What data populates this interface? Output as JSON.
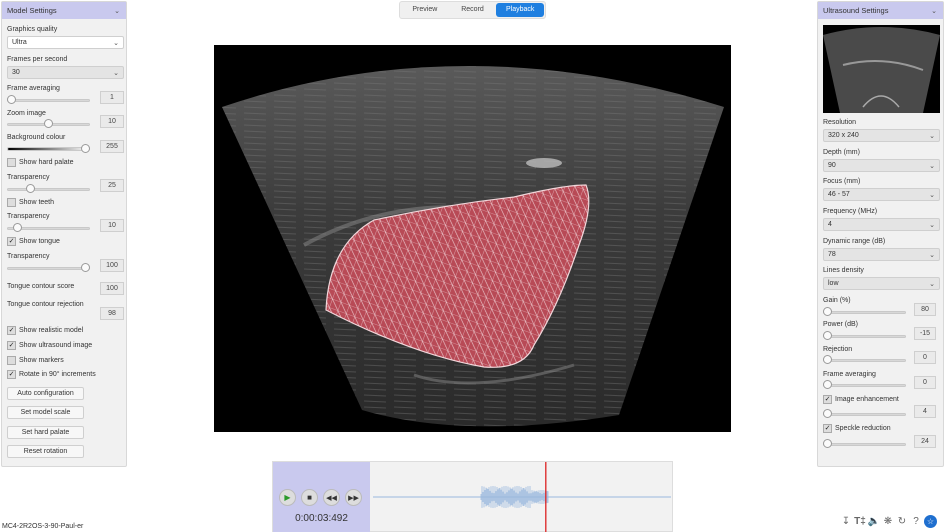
{
  "left_panel": {
    "title": "Model Settings",
    "graphics_quality": {
      "label": "Graphics quality",
      "value": "Ultra"
    },
    "fps": {
      "label": "Frames per second",
      "value": "30"
    },
    "frame_averaging": {
      "label": "Frame averaging",
      "value": "1",
      "level": 0.0
    },
    "zoom_image": {
      "label": "Zoom image",
      "value": "10",
      "level": 0.5
    },
    "background_colour": {
      "label": "Background colour",
      "value": "255",
      "level": 1.0
    },
    "show_hard_palate": {
      "label": "Show hard palate",
      "checked": false
    },
    "transparency_1": {
      "label": "Transparency",
      "value": "25",
      "level": 0.25
    },
    "show_teeth": {
      "label": "Show teeth",
      "checked": false
    },
    "transparency_2": {
      "label": "Transparency",
      "value": "10",
      "level": 0.1
    },
    "show_tongue": {
      "label": "Show tongue",
      "checked": true
    },
    "transparency_3": {
      "label": "Transparency",
      "value": "100",
      "level": 1.0
    },
    "tongue_contour_score": {
      "label": "Tongue contour score",
      "value": "100"
    },
    "tongue_contour_rejection": {
      "label": "Tongue contour rejection",
      "value": "98"
    },
    "show_realistic_model": {
      "label": "Show realistic model",
      "checked": true
    },
    "show_ultrasound_image": {
      "label": "Show ultrasound image",
      "checked": true
    },
    "show_markers": {
      "label": "Show markers",
      "checked": false
    },
    "rotate_90": {
      "label": "Rotate in 90° increments",
      "checked": true
    },
    "buttons": {
      "auto": "Auto configuration",
      "scale": "Set model scale",
      "palate": "Set hard palate",
      "reset": "Reset rotation"
    }
  },
  "tabs": [
    "Preview",
    "Record",
    "Playback"
  ],
  "active_tab": "Playback",
  "right_panel": {
    "title": "Ultrasound Settings",
    "resolution": {
      "label": "Resolution",
      "value": "320 x 240"
    },
    "depth": {
      "label": "Depth (mm)",
      "value": "90"
    },
    "focus": {
      "label": "Focus (mm)",
      "value": "46 - 57"
    },
    "frequency": {
      "label": "Frequency (MHz)",
      "value": "4"
    },
    "dynamic_range": {
      "label": "Dynamic range (dB)",
      "value": "78"
    },
    "lines_density": {
      "label": "Lines density",
      "value": "low"
    },
    "gain": {
      "label": "Gain (%)",
      "value": "80"
    },
    "power": {
      "label": "Power (dB)",
      "value": "-15"
    },
    "rejection": {
      "label": "Rejection",
      "value": "0"
    },
    "frame_averaging": {
      "label": "Frame averaging",
      "value": "0"
    },
    "image_enhancement": {
      "label": "Image enhancement",
      "checked": true,
      "value": "4"
    },
    "speckle_reduction": {
      "label": "Speckle reduction",
      "checked": true,
      "value": "24"
    }
  },
  "playback": {
    "time": "0:00:03:492",
    "position": 0.58
  },
  "footer": {
    "filename": "MC4-2R2OS-3-90-Paul-er"
  },
  "colors": {
    "accent": "#1f7fe0",
    "header": "#c9c9ee",
    "tongue": "#b84a56"
  },
  "icons": [
    "download-icon",
    "text-icon",
    "sound-icon",
    "settings-icon",
    "refresh-icon",
    "help-icon",
    "accessibility-icon"
  ]
}
